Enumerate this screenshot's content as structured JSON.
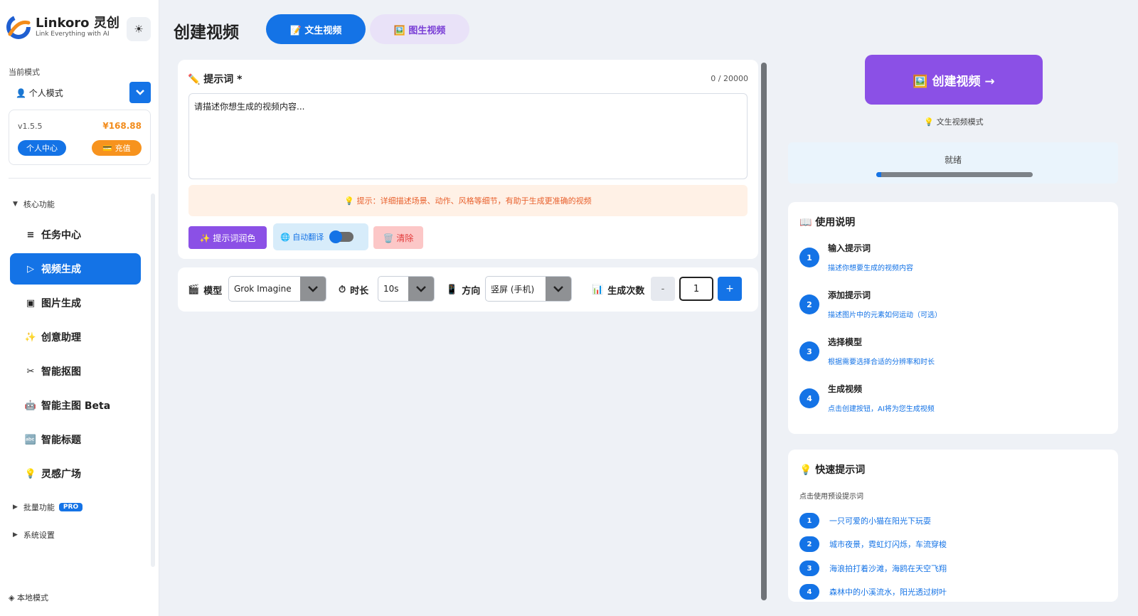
{
  "brand": {
    "name": "Linkoro 灵创",
    "tagline": "Link Everything with AI",
    "theme_icon": "sun-icon"
  },
  "sidebar": {
    "mode_label": "当前模式",
    "mode_value": "👤 个人模式",
    "version": "v1.5.5",
    "balance": "¥168.88",
    "user_center": "个人中心",
    "recharge": "💳 充值",
    "core_section": "核心功能",
    "nav": [
      {
        "icon": "≡",
        "label": "任务中心"
      },
      {
        "icon": "▷",
        "label": "视频生成"
      },
      {
        "icon": "▣",
        "label": "图片生成"
      },
      {
        "icon": "✨",
        "label": "创意助理"
      },
      {
        "icon": "✂",
        "label": "智能抠图"
      },
      {
        "icon": "🤖",
        "label": "智能主图 Beta"
      },
      {
        "icon": "🔤",
        "label": "智能标题"
      },
      {
        "icon": "💡",
        "label": "灵感广场"
      }
    ],
    "batch_section": "批量功能",
    "pro_badge": "PRO",
    "settings_section": "系统设置",
    "local_mode": "◈ 本地模式"
  },
  "header": {
    "title": "创建视频",
    "tab_text": "📝 文生视频",
    "tab_image": "🖼️ 图生视频"
  },
  "prompt": {
    "label": "✏️ 提示词 *",
    "count": "0 / 20000",
    "placeholder": "请描述你想生成的视频内容...",
    "tip": "💡 提示：详细描述场景、动作、风格等细节，有助于生成更准确的视频",
    "polish": "✨ 提示词润色",
    "translate": "🌐 自动翻译",
    "translate_on": false,
    "clear": "🗑️ 清除"
  },
  "settings": {
    "model_label": "模型",
    "model_icon": "🎬",
    "model_value": "Grok Imagine",
    "duration_label": "时长",
    "duration_icon": "⏱",
    "duration_value": "10s",
    "orientation_label": "方向",
    "orientation_icon": "📱",
    "orientation_value": "竖屏 (手机)",
    "count_label": "生成次数",
    "count_icon": "📊",
    "count_value": "1",
    "minus": "-",
    "plus": "+"
  },
  "action": {
    "create": "🖼️ 创建视频 →",
    "mode_hint": "💡 文生视频模式",
    "status": "就绪",
    "progress": 0.03
  },
  "guide": {
    "title": "📖 使用说明",
    "steps": [
      {
        "num": "1",
        "title": "输入提示词",
        "desc": "描述你想要生成的视频内容"
      },
      {
        "num": "2",
        "title": "添加提示词",
        "desc": "描述图片中的元素如何运动（可选）"
      },
      {
        "num": "3",
        "title": "选择模型",
        "desc": "根据需要选择合适的分辨率和时长"
      },
      {
        "num": "4",
        "title": "生成视频",
        "desc": "点击创建按钮，AI将为您生成视频"
      }
    ]
  },
  "quick": {
    "title": "💡 快速提示词",
    "subtitle": "点击使用预设提示词",
    "items": [
      {
        "num": "1",
        "text": "一只可爱的小猫在阳光下玩耍"
      },
      {
        "num": "2",
        "text": "城市夜景，霓虹灯闪烁，车流穿梭"
      },
      {
        "num": "3",
        "text": "海浪拍打着沙滩，海鸥在天空飞翔"
      },
      {
        "num": "4",
        "text": "森林中的小溪流水，阳光透过树叶"
      }
    ]
  },
  "colors": {
    "primary": "#1473e6",
    "purple": "#8b50e6",
    "orange": "#f7931e"
  }
}
